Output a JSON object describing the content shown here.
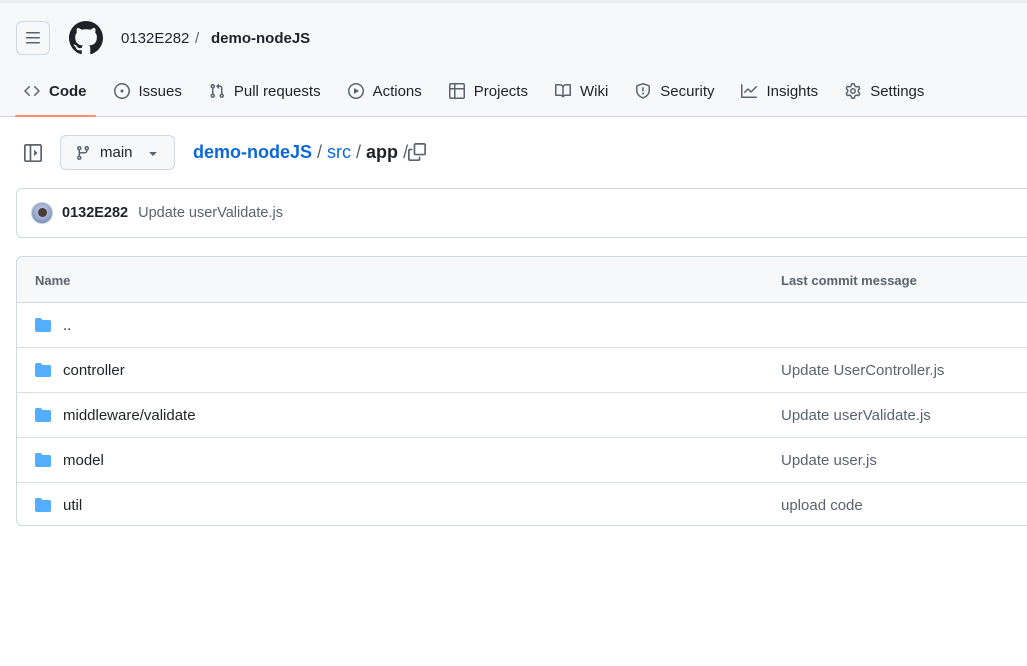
{
  "header": {
    "owner": "0132E282",
    "separator": "/",
    "repo": "demo-nodeJS"
  },
  "tabs": [
    {
      "label": "Code",
      "icon": "code-icon",
      "active": true
    },
    {
      "label": "Issues",
      "icon": "issue-opened-icon"
    },
    {
      "label": "Pull requests",
      "icon": "git-pull-request-icon"
    },
    {
      "label": "Actions",
      "icon": "play-icon"
    },
    {
      "label": "Projects",
      "icon": "table-icon"
    },
    {
      "label": "Wiki",
      "icon": "book-icon"
    },
    {
      "label": "Security",
      "icon": "shield-icon"
    },
    {
      "label": "Insights",
      "icon": "graph-icon"
    },
    {
      "label": "Settings",
      "icon": "gear-icon"
    }
  ],
  "toolbar": {
    "branch": "main"
  },
  "path": {
    "repo": "demo-nodeJS",
    "dir": "src",
    "current": "app",
    "sep": "/"
  },
  "commit": {
    "author": "0132E282",
    "message": "Update userValidate.js"
  },
  "table": {
    "col_name": "Name",
    "col_message": "Last commit message",
    "rows": [
      {
        "name": "..",
        "message": ""
      },
      {
        "name": "controller",
        "message": "Update UserController.js"
      },
      {
        "name": "middleware/validate",
        "message": "Update userValidate.js"
      },
      {
        "name": "model",
        "message": "Update user.js"
      },
      {
        "name": "util",
        "message": "upload code"
      }
    ]
  },
  "colors": {
    "accent_link": "#0969da",
    "tab_underline": "#fd8c73",
    "folder": "#54aeff"
  }
}
